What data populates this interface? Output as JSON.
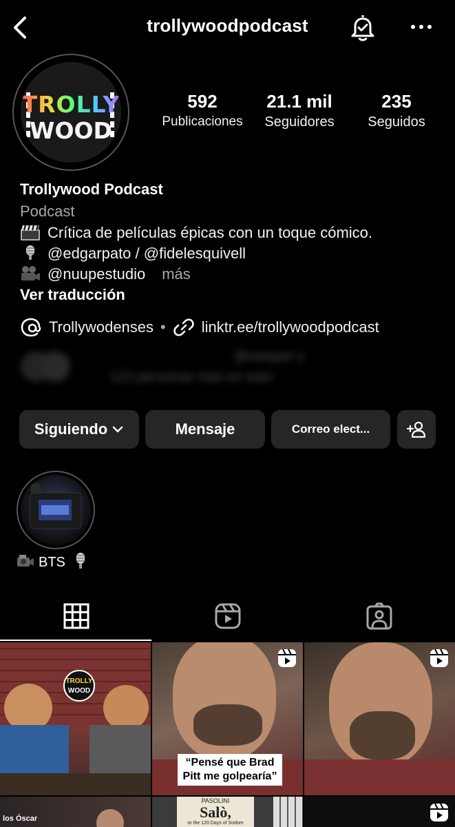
{
  "header": {
    "username": "trollywoodpodcast"
  },
  "avatar": {
    "logo_top": "TROLLY",
    "logo_bottom": "WOOD"
  },
  "stats": [
    {
      "value": "592",
      "label": "Publicaciones"
    },
    {
      "value": "21.1 mil",
      "label": "Seguidores"
    },
    {
      "value": "235",
      "label": "Seguidos"
    }
  ],
  "bio": {
    "name": "Trollywood Podcast",
    "category": "Podcast",
    "line1": "Crítica de películas épicas con un toque cómico.",
    "line2": "@edgarpato / @fidelesquivell",
    "line3": "@nuupestudio",
    "more": "más",
    "translate": "Ver traducción",
    "threads_link": "Trollywodenses",
    "separator": "•",
    "external_link": "linktr.ee/trollywoodpodcast",
    "blurred_line1": "@varqasr y",
    "blurred_line2": "123 personas más en esto"
  },
  "buttons": {
    "following": "Siguiendo",
    "message": "Mensaje",
    "email": "Correo elect..."
  },
  "highlight": {
    "label": "BTS"
  },
  "grid": {
    "post1_logo_top": "TROLLY",
    "post1_logo_bottom": "WOOD",
    "post2_caption": "“Pensé que Brad Pitt me golpearía”",
    "post4_text": "los Óscar",
    "post5_text1": "PASOLINI",
    "post5_text2": "Salò,",
    "post5_text3": "or the 120 Days of Sodom"
  },
  "colors": {
    "background": "#000000",
    "button": "#262626",
    "muted_text": "#a8a8a8"
  }
}
